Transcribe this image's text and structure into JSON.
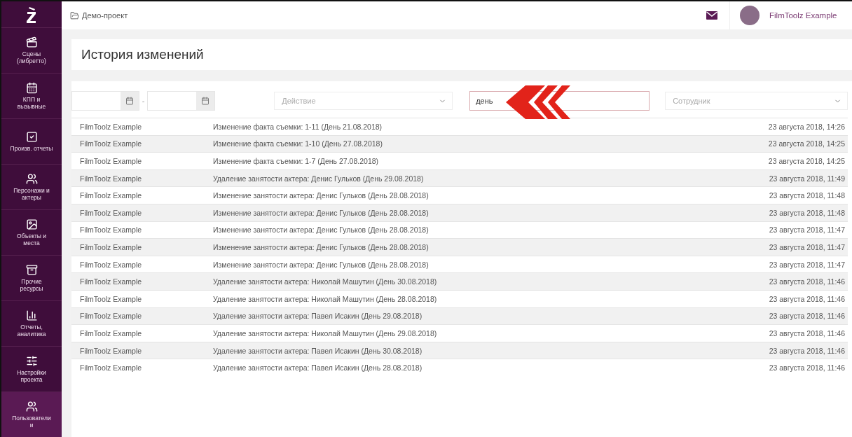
{
  "sidebar": {
    "items": [
      {
        "label": "Сцены (либретто)",
        "selected": false
      },
      {
        "label": "КПП и вызывные",
        "selected": false
      },
      {
        "label": "Произв. отчеты",
        "selected": false
      },
      {
        "label": "Персонажи и актеры",
        "selected": false
      },
      {
        "label": "Объекты и места",
        "selected": false
      },
      {
        "label": "Прочие ресурсы",
        "selected": false
      },
      {
        "label": "Отчеты, аналитика",
        "selected": false
      },
      {
        "label": "Настройки проекта",
        "selected": false
      },
      {
        "label": "Пользователи и",
        "selected": true
      }
    ]
  },
  "topbar": {
    "project": "Демо-проект",
    "user": "FilmToolz Example"
  },
  "page_title": "История изменений",
  "filters": {
    "date_separator": "-",
    "action": {
      "placeholder": "Действие"
    },
    "search": {
      "value": "день"
    },
    "employee": {
      "placeholder": "Сотрудник"
    }
  },
  "table": {
    "rows": [
      {
        "user": "FilmToolz Example",
        "action": "Изменение факта съемки: 1-11 (День 21.08.2018)",
        "date": "23 августа 2018, 14:26"
      },
      {
        "user": "FilmToolz Example",
        "action": "Изменение факта съемки: 1-10 (День 27.08.2018)",
        "date": "23 августа 2018, 14:25"
      },
      {
        "user": "FilmToolz Example",
        "action": "Изменение факта съемки: 1-7 (День 27.08.2018)",
        "date": "23 августа 2018, 14:25"
      },
      {
        "user": "FilmToolz Example",
        "action": "Удаление занятости актера: Денис Гульков (День 29.08.2018)",
        "date": "23 августа 2018, 11:49"
      },
      {
        "user": "FilmToolz Example",
        "action": "Изменение занятости актера: Денис Гульков (День 28.08.2018)",
        "date": "23 августа 2018, 11:48"
      },
      {
        "user": "FilmToolz Example",
        "action": "Изменение занятости актера: Денис Гульков (День 28.08.2018)",
        "date": "23 августа 2018, 11:48"
      },
      {
        "user": "FilmToolz Example",
        "action": "Изменение занятости актера: Денис Гульков (День 28.08.2018)",
        "date": "23 августа 2018, 11:47"
      },
      {
        "user": "FilmToolz Example",
        "action": "Изменение занятости актера: Денис Гульков (День 28.08.2018)",
        "date": "23 августа 2018, 11:47"
      },
      {
        "user": "FilmToolz Example",
        "action": "Изменение занятости актера: Денис Гульков (День 28.08.2018)",
        "date": "23 августа 2018, 11:47"
      },
      {
        "user": "FilmToolz Example",
        "action": "Удаление занятости актера: Николай Машутин (День 30.08.2018)",
        "date": "23 августа 2018, 11:46"
      },
      {
        "user": "FilmToolz Example",
        "action": "Удаление занятости актера: Николай Машутин (День 28.08.2018)",
        "date": "23 августа 2018, 11:46"
      },
      {
        "user": "FilmToolz Example",
        "action": "Удаление занятости актера: Павел Исакин (День 29.08.2018)",
        "date": "23 августа 2018, 11:46"
      },
      {
        "user": "FilmToolz Example",
        "action": "Удаление занятости актера: Николай Машутин (День 29.08.2018)",
        "date": "23 августа 2018, 11:46"
      },
      {
        "user": "FilmToolz Example",
        "action": "Удаление занятости актера: Павел Исакин (День 30.08.2018)",
        "date": "23 августа 2018, 11:46"
      },
      {
        "user": "FilmToolz Example",
        "action": "Удаление занятости актера: Павел Исакин (День 28.08.2018)",
        "date": "23 августа 2018, 11:46"
      }
    ]
  }
}
